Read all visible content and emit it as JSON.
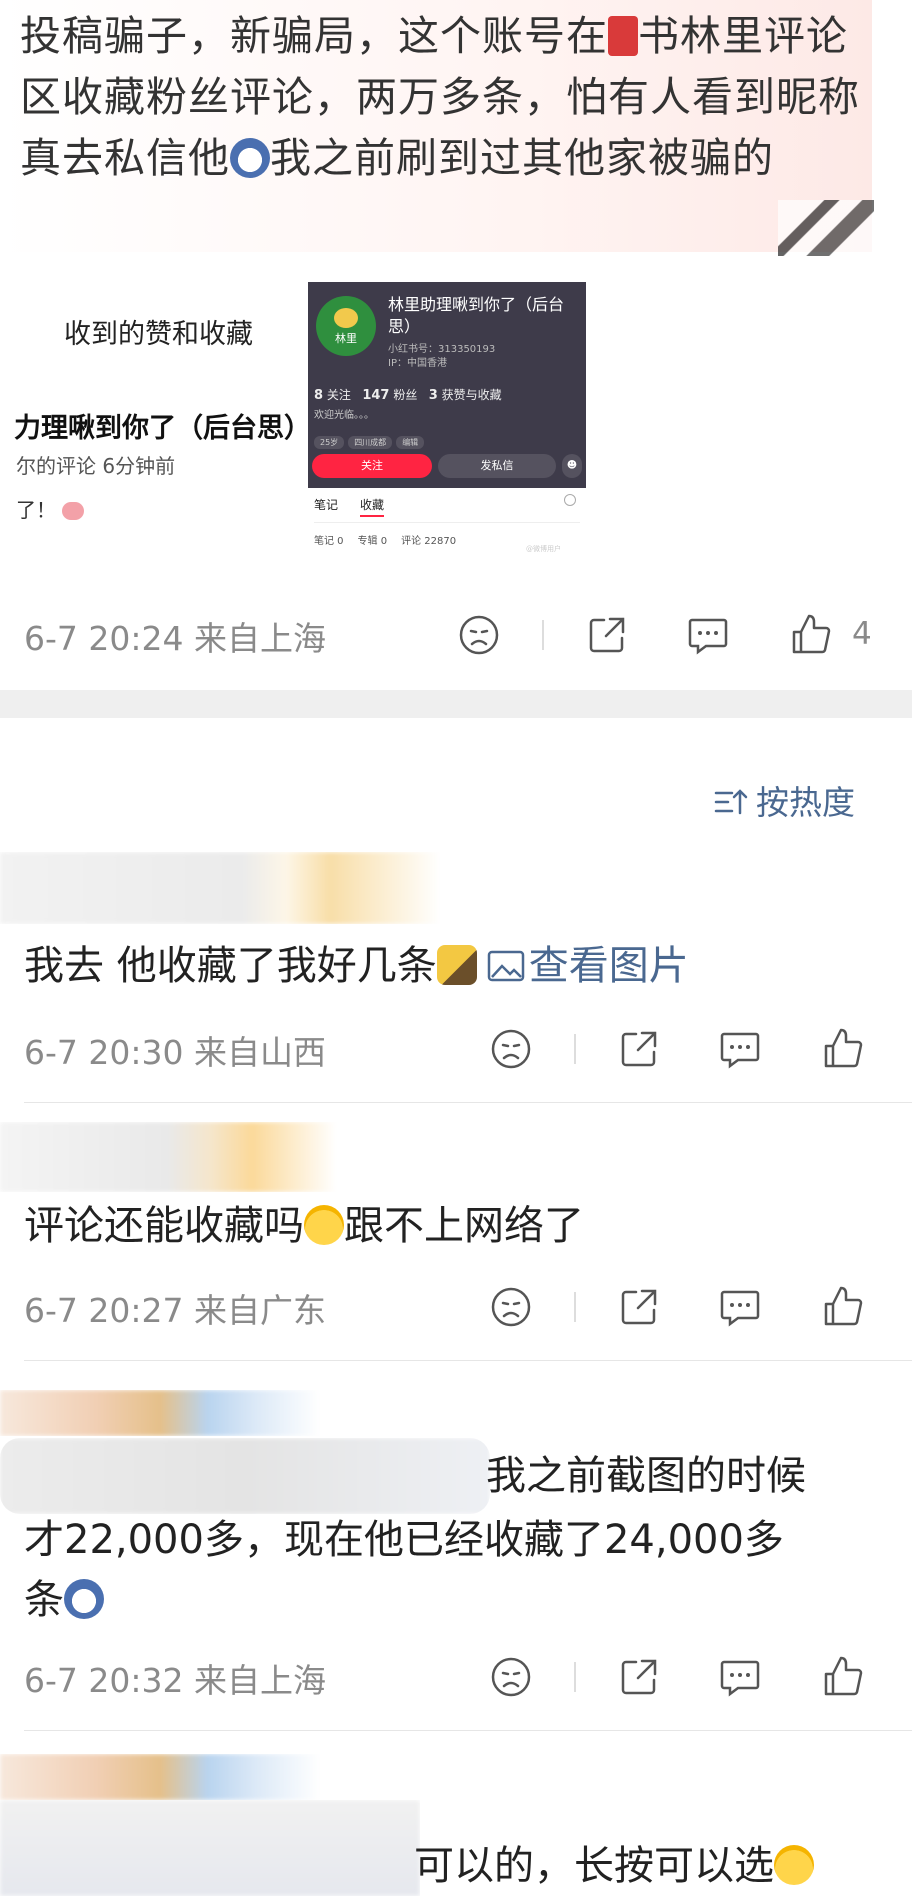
{
  "post": {
    "text_1": "投稿骗子，新骗局，这个账号在",
    "text_2": "书林里评论区收藏粉丝评论，两万多条，怕有人看到昵称真去私信他",
    "text_3": "我之前刷到过其他家被骗的",
    "meta": "6-7 20:24  来自上海",
    "like_count": "4"
  },
  "screenshot_left": {
    "title": "收到的赞和收藏",
    "name": "力理啾到你了（后台思）",
    "sub": "尔的评论  6分钟前",
    "tail": "了！"
  },
  "screenshot_right": {
    "avatar_label": "林里",
    "name": "林里助理啾到你了（后台思）",
    "id_line": "小红书号：313350193",
    "ip_line": "IP：中国香港",
    "stats": {
      "follow_num": "8",
      "follow_label": "关注",
      "fans_num": "147",
      "fans_label": "粉丝",
      "likes_num": "3",
      "likes_label": "获赞与收藏"
    },
    "bio": "欢迎光临。。。",
    "tags": [
      "25岁",
      "四川成都",
      "编辑"
    ],
    "follow_btn": "关注",
    "msg_btn": "发私信",
    "tabs": [
      "笔记",
      "收藏"
    ],
    "counts": [
      "笔记 0",
      "专辑 0",
      "评论 22870"
    ],
    "watermark": "@微博用户"
  },
  "sort": {
    "label": "按热度"
  },
  "comments": [
    {
      "text": "我去 他收藏了我好几条",
      "link": "查看图片",
      "meta": "6-7 20:30  来自山西"
    },
    {
      "text_1": "评论还能收藏吗",
      "text_2": "跟不上网络了",
      "meta": "6-7 20:27  来自广东"
    },
    {
      "text_1": "我之前截图的时候",
      "text_2": "才22,000多，现在他已经收藏了24,000多",
      "text_3": "条",
      "meta": "6-7 20:32  来自上海"
    },
    {
      "text": "可以的，长按可以选"
    }
  ],
  "icons": [
    "dislike-icon",
    "share-icon",
    "comment-icon",
    "like-icon",
    "sort-icon",
    "image-icon"
  ],
  "colors": {
    "link": "#4a6890",
    "meta": "#8a8a8a",
    "accent_red": "#ff2442"
  }
}
